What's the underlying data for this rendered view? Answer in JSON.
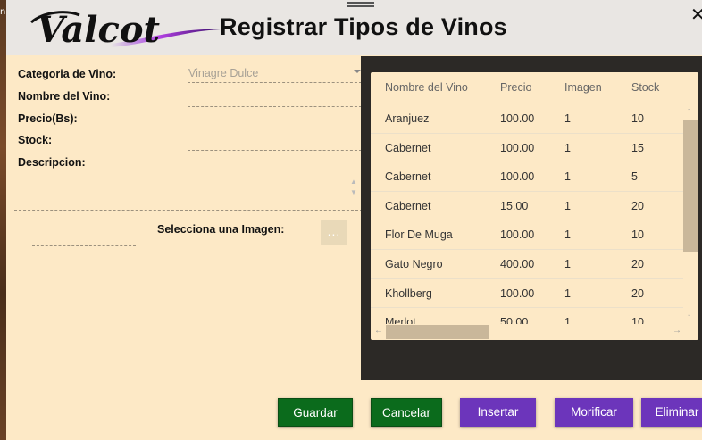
{
  "app": {
    "title": "Registrar Tipos de Vinos",
    "logo_text": "Valcot",
    "close_symbol": "✕"
  },
  "background_edge_text": "n",
  "form": {
    "category_label": "Categoria de Vino:",
    "category_value": "Vinagre Dulce",
    "name_label": "Nombre del Vino:",
    "name_value": "",
    "price_label": "Precio(Bs):",
    "price_value": "",
    "stock_label": "Stock:",
    "stock_value": "",
    "description_label": "Descripcion:",
    "description_value": "",
    "image_label": "Selecciona una Imagen:",
    "image_value": "",
    "browse_label": "..."
  },
  "table": {
    "columns": [
      "Nombre del Vino",
      "Precio",
      "Imagen",
      "Stock"
    ],
    "rows": [
      [
        "Aranjuez",
        "100.00",
        "1",
        "10"
      ],
      [
        "Cabernet",
        "100.00",
        "1",
        "15"
      ],
      [
        "Cabernet",
        "100.00",
        "1",
        "5"
      ],
      [
        "Cabernet",
        "15.00",
        "1",
        "20"
      ],
      [
        "Flor De Muga",
        "100.00",
        "1",
        "10"
      ],
      [
        "Gato Negro",
        "400.00",
        "1",
        "20"
      ],
      [
        "Khollberg",
        "100.00",
        "1",
        "20"
      ],
      [
        "Merlot",
        "50.00",
        "1",
        "10"
      ]
    ],
    "scroll_up": "↑",
    "scroll_down": "↓",
    "scroll_left": "←",
    "scroll_right": "→"
  },
  "buttons": {
    "guardar": "Guardar",
    "cancelar": "Cancelar",
    "insertar": "Insertar",
    "modificar": "Morificar",
    "eliminar": "Eliminar"
  },
  "colors": {
    "form_bg": "#fde9c6",
    "header_bg": "#e9e6e3",
    "table_panel_bg": "#2c2926",
    "green_button": "#0b6b1c",
    "purple_button": "#6c35bb",
    "scroll_thumb": "#c9b79a"
  }
}
